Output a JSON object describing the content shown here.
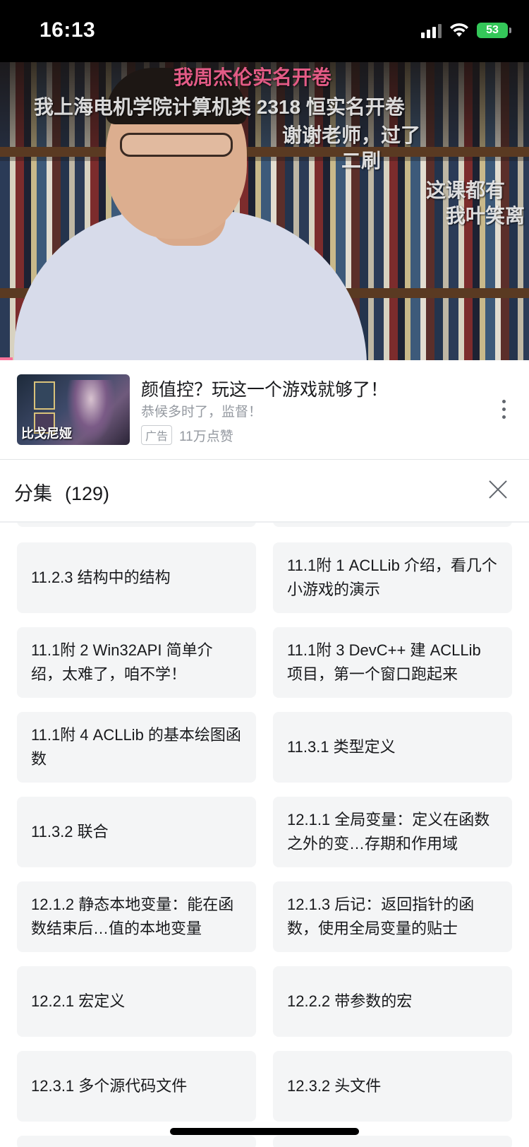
{
  "status_bar": {
    "time": "16:13",
    "battery": "53"
  },
  "video": {
    "danmaku": [
      "我周杰伦实名开卷",
      "我上海电机学院计算机类 2318 恒实名开卷",
      "谢谢老师，过了",
      "二刷",
      "这课都有",
      "我叶笑离"
    ]
  },
  "ad": {
    "thumb_label": "比戈尼娅",
    "title": "颜值控？玩这一个游戏就够了！",
    "subtitle": "恭候多时了，监督！",
    "badge": "广告",
    "likes": "11万点赞"
  },
  "episodes_panel": {
    "title": "分集",
    "count": "(129)",
    "items": [
      {
        "label": "11.2.3 结构中的结构"
      },
      {
        "label": "11.1附 1 ACLLib 介绍，看几个小游戏的演示"
      },
      {
        "label": "11.1附 2 Win32API 简单介绍，太难了，咱不学！"
      },
      {
        "label": "11.1附 3 DevC++ 建 ACLLib 项目，第一个窗口跑起来"
      },
      {
        "label": "11.1附 4 ACLLib 的基本绘图函数"
      },
      {
        "label": "11.3.1 类型定义"
      },
      {
        "label": "11.3.2 联合"
      },
      {
        "label": "12.1.1 全局变量：定义在函数之外的变…存期和作用域"
      },
      {
        "label": "12.1.2 静态本地变量：能在函数结束后…值的本地变量"
      },
      {
        "label": "12.1.3 后记：返回指针的函数，使用全局变量的贴士"
      },
      {
        "label": "12.2.1 宏定义"
      },
      {
        "label": "12.2.2 带参数的宏"
      },
      {
        "label": "12.3.1 多个源代码文件"
      },
      {
        "label": "12.3.2 头文件"
      }
    ]
  }
}
